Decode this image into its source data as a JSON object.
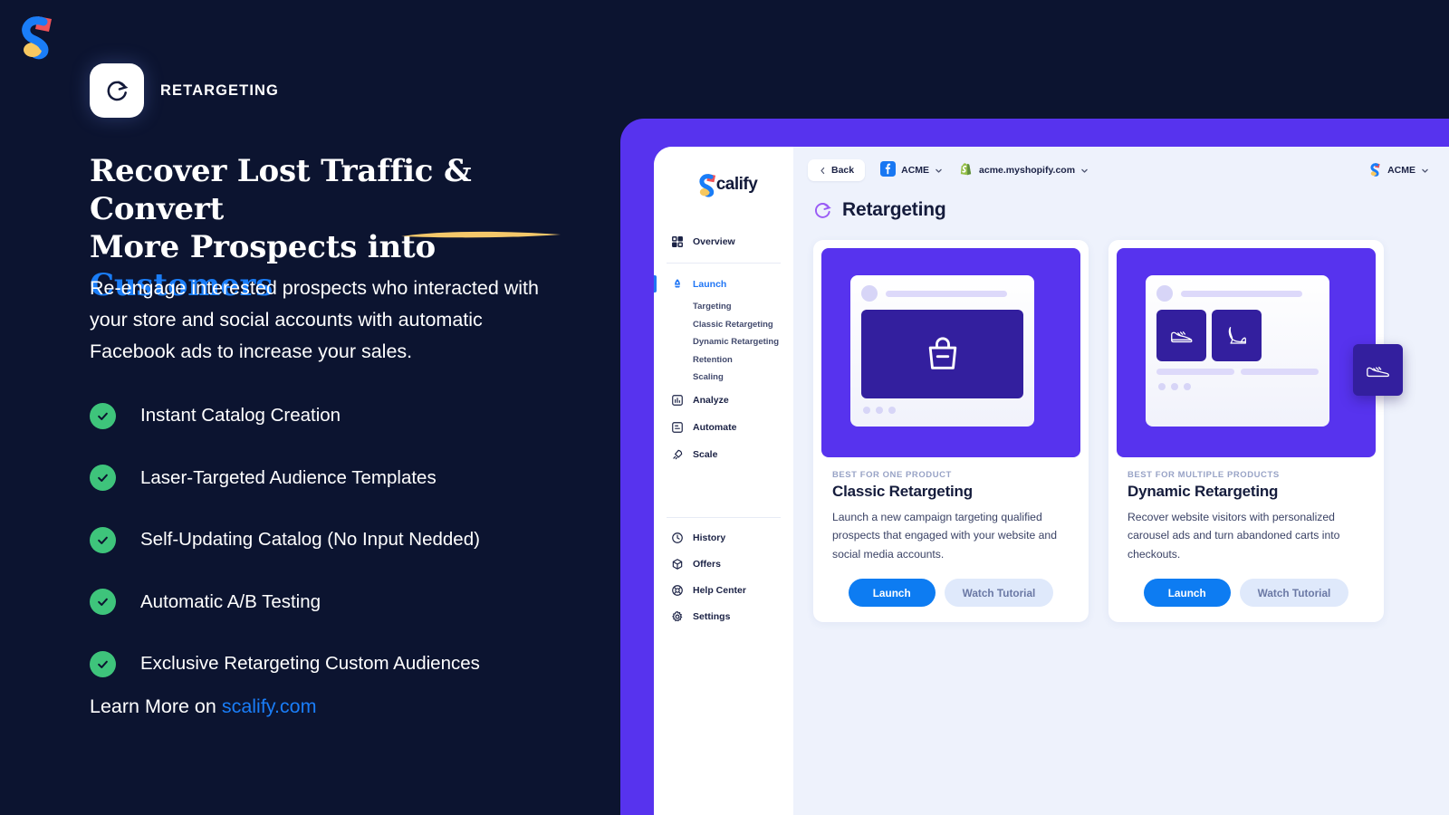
{
  "promo": {
    "brand_logo_icon": "scalify-logo-icon",
    "badge": {
      "icon": "retarget-refresh-icon",
      "label": "RETARGETING"
    },
    "headline": {
      "line1": "Recover Lost Traffic & Convert",
      "line2_plain": "More Prospects into ",
      "line2_highlight": "Customers",
      "highlight_color": "#1a7df7",
      "underline_color": "#f5c86a"
    },
    "subtitle": "Re-engage interested prospects who interacted with your store and social accounts with automatic Facebook ads to increase your sales.",
    "features": [
      "Instant Catalog Creation",
      "Laser-Targeted Audience Templates",
      "Self-Updating Catalog (No Input Nedded)",
      "Automatic A/B Testing",
      "Exclusive Retargeting Custom Audiences"
    ],
    "check_color": "#3ec47b",
    "learn_more": {
      "prefix": "Learn More on ",
      "link": "scalify.com"
    },
    "background_color": "#0c1430"
  },
  "app": {
    "frame_color": "#5733ee",
    "canvas_color": "#eef2fc",
    "sidebar": {
      "logo_text": "calify",
      "logo_icon": "scalify-logo-icon",
      "primary": [
        {
          "label": "Overview",
          "icon": "grid-icon",
          "active": false
        }
      ],
      "launch": {
        "label": "Launch",
        "icon": "rocket-icon",
        "active": true,
        "accent": "#2076f5"
      },
      "sub_items": [
        "Targeting",
        "Classic Retargeting",
        "Dynamic Retargeting",
        "Retention",
        "Scaling"
      ],
      "secondary": [
        {
          "label": "Analyze",
          "icon": "bar-chart-icon"
        },
        {
          "label": "Automate",
          "icon": "automate-icon"
        },
        {
          "label": "Scale",
          "icon": "scale-rocket-icon"
        }
      ],
      "footer": [
        {
          "label": "History",
          "icon": "clock-icon"
        },
        {
          "label": "Offers",
          "icon": "box-icon"
        },
        {
          "label": "Help Center",
          "icon": "lifebuoy-icon"
        },
        {
          "label": "Settings",
          "icon": "gear-icon"
        }
      ]
    },
    "topbar": {
      "back_label": "Back",
      "back_icon": "chevron-left-icon",
      "facebook_icon": "facebook-icon",
      "facebook_account": "ACME",
      "shopify_icon": "shopify-bag-icon",
      "shopify_store": "acme.myshopify.com",
      "user_icon": "scalify-logo-icon",
      "user_account": "ACME",
      "chevron_icon": "chevron-down-icon"
    },
    "page": {
      "title": "Retargeting",
      "title_icon": "retarget-refresh-icon",
      "title_icon_color": "#9a5cf5"
    },
    "cards": [
      {
        "eyebrow": "BEST FOR ONE PRODUCT",
        "title": "Classic Retargeting",
        "description": "Launch a new campaign targeting qualified prospects that engaged with your website and social media accounts.",
        "illustration": "single-product-post-illustration",
        "primary_button": "Launch",
        "secondary_button": "Watch Tutorial"
      },
      {
        "eyebrow": "BEST FOR MULTIPLE PRODUCTS",
        "title": "Dynamic Retargeting",
        "description": "Recover website visitors with personalized carousel ads and turn abandoned carts into checkouts.",
        "illustration": "carousel-products-post-illustration",
        "primary_button": "Launch",
        "secondary_button": "Watch Tutorial"
      }
    ]
  }
}
